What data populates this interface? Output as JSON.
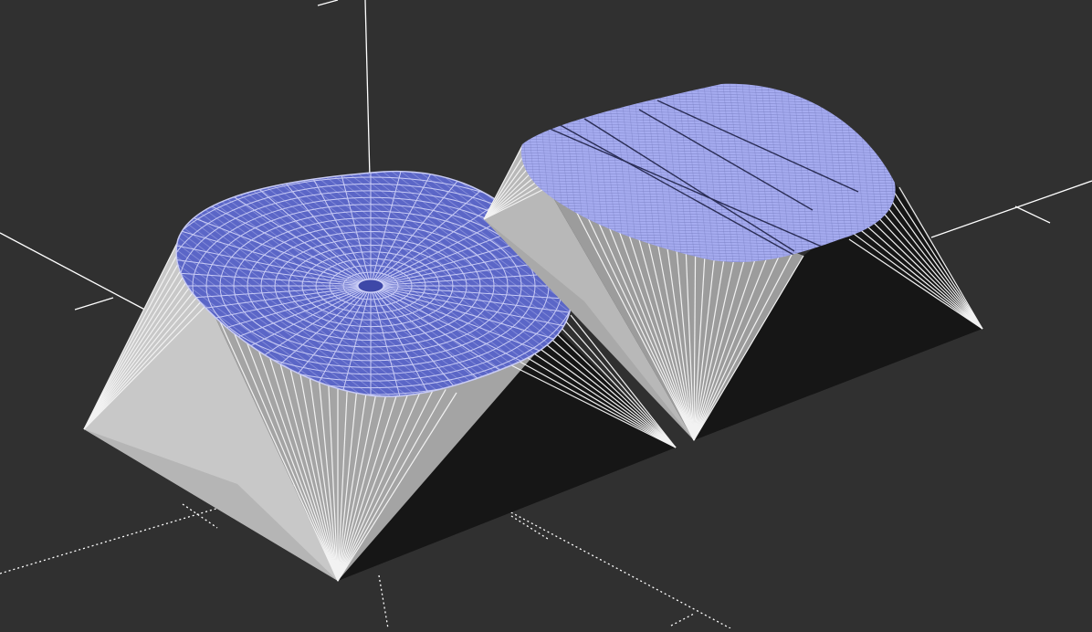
{
  "scene": {
    "background": "#303030",
    "axis_color": "#ffffff",
    "face_light": "#c8c8c8",
    "face_mid": "#9b9b9b",
    "face_dark": "#161616",
    "keycap_left_top": "#5b66c7",
    "keycap_left_mesh": "#c9ccf5",
    "keycap_right_top": "#a6acf0",
    "keycap_right_mesh": "#6e73b8",
    "edge_line": "#f0f0f0",
    "objects": [
      "keycap-left",
      "keycap-right"
    ]
  }
}
